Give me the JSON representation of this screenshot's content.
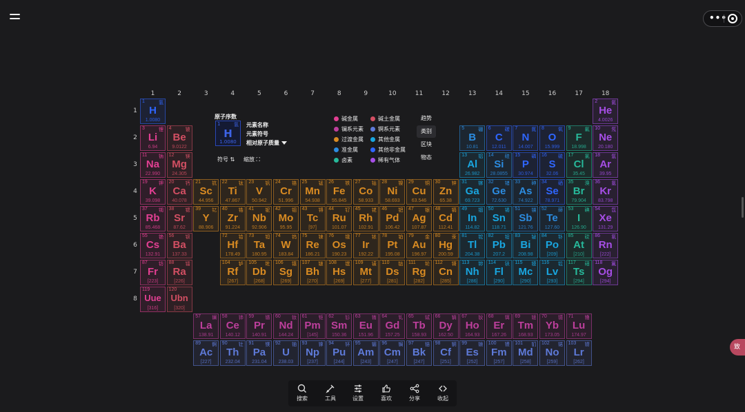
{
  "columns": [
    "1",
    "2",
    "3",
    "4",
    "5",
    "6",
    "7",
    "8",
    "9",
    "10",
    "11",
    "12",
    "13",
    "14",
    "15",
    "16",
    "17",
    "18"
  ],
  "rows": [
    "1",
    "2",
    "3",
    "4",
    "5",
    "6",
    "7",
    "8"
  ],
  "colors": {
    "nonmetal": "#2f66ff",
    "noble": "#a64ee6",
    "alkali": "#e23f92",
    "alkaline": "#d34f63",
    "transition": "#d98b22",
    "post_transition": "#19a6e0",
    "metalloid": "#2c8ce0",
    "halogen": "#27b99a",
    "lanthanide": "#bd3f9c",
    "actinide": "#5e7ad8"
  },
  "legend_key": {
    "number_label": "原子序数",
    "name_label": "元素名称",
    "symbol_label": "元素符号",
    "mass_label": "相对原子质量",
    "sample": {
      "num": "1",
      "zh": "氢",
      "sym": "H",
      "mass": "1.0080"
    },
    "sort_symbol": "符号",
    "zoom": "缩放"
  },
  "legend": [
    {
      "label": "碱金属",
      "color": "#e23f92"
    },
    {
      "label": "碱土金属",
      "color": "#d34f63"
    },
    {
      "label": "镧系元素",
      "color": "#bd3f9c"
    },
    {
      "label": "锕系元素",
      "color": "#5e7ad8"
    },
    {
      "label": "过渡金属",
      "color": "#d98b22"
    },
    {
      "label": "其他金属",
      "color": "#19a6e0"
    },
    {
      "label": "准金属",
      "color": "#2c8ce0"
    },
    {
      "label": "其他非金属",
      "color": "#2f66ff"
    },
    {
      "label": "卤素",
      "color": "#27b99a"
    },
    {
      "label": "稀有气体",
      "color": "#a64ee6"
    }
  ],
  "view_switch": [
    "趋势",
    "类别",
    "区块",
    "物态"
  ],
  "view_switch_active": "类别",
  "toolbar": [
    {
      "label": "搜索",
      "icon": "search-icon"
    },
    {
      "label": "工具",
      "icon": "tool-icon"
    },
    {
      "label": "设置",
      "icon": "settings-icon"
    },
    {
      "label": "喜欢",
      "icon": "like-icon"
    },
    {
      "label": "分享",
      "icon": "share-icon"
    },
    {
      "label": "收起",
      "icon": "collapse-icon"
    }
  ],
  "side_tab": "致",
  "elements": [
    {
      "n": "1",
      "zh": "氢",
      "s": "H",
      "m": "1.0080",
      "c": "nonmetal",
      "r": 1,
      "g": 1
    },
    {
      "n": "2",
      "zh": "氦",
      "s": "He",
      "m": "4.0026",
      "c": "noble",
      "r": 1,
      "g": 18
    },
    {
      "n": "3",
      "zh": "锂",
      "s": "Li",
      "m": "6.94",
      "c": "alkali",
      "r": 2,
      "g": 1
    },
    {
      "n": "4",
      "zh": "铍",
      "s": "Be",
      "m": "9.0122",
      "c": "alkaline",
      "r": 2,
      "g": 2
    },
    {
      "n": "5",
      "zh": "硼",
      "s": "B",
      "m": "10.81",
      "c": "metalloid",
      "r": 2,
      "g": 13
    },
    {
      "n": "6",
      "zh": "碳",
      "s": "C",
      "m": "12.011",
      "c": "nonmetal",
      "r": 2,
      "g": 14
    },
    {
      "n": "7",
      "zh": "氮",
      "s": "N",
      "m": "14.007",
      "c": "nonmetal",
      "r": 2,
      "g": 15
    },
    {
      "n": "8",
      "zh": "氧",
      "s": "O",
      "m": "15.999",
      "c": "nonmetal",
      "r": 2,
      "g": 16
    },
    {
      "n": "9",
      "zh": "氟",
      "s": "F",
      "m": "18.998",
      "c": "halogen",
      "r": 2,
      "g": 17
    },
    {
      "n": "10",
      "zh": "氖",
      "s": "Ne",
      "m": "20.180",
      "c": "noble",
      "r": 2,
      "g": 18
    },
    {
      "n": "11",
      "zh": "钠",
      "s": "Na",
      "m": "22.990",
      "c": "alkali",
      "r": 3,
      "g": 1
    },
    {
      "n": "12",
      "zh": "镁",
      "s": "Mg",
      "m": "24.305",
      "c": "alkaline",
      "r": 3,
      "g": 2
    },
    {
      "n": "13",
      "zh": "铝",
      "s": "Al",
      "m": "26.982",
      "c": "post_transition",
      "r": 3,
      "g": 13
    },
    {
      "n": "14",
      "zh": "硅",
      "s": "Si",
      "m": "28.0855",
      "c": "metalloid",
      "r": 3,
      "g": 14
    },
    {
      "n": "15",
      "zh": "磷",
      "s": "P",
      "m": "30.974",
      "c": "nonmetal",
      "r": 3,
      "g": 15
    },
    {
      "n": "16",
      "zh": "硫",
      "s": "S",
      "m": "32.06",
      "c": "nonmetal",
      "r": 3,
      "g": 16
    },
    {
      "n": "17",
      "zh": "氯",
      "s": "Cl",
      "m": "35.45",
      "c": "halogen",
      "r": 3,
      "g": 17
    },
    {
      "n": "18",
      "zh": "氩",
      "s": "Ar",
      "m": "39.95",
      "c": "noble",
      "r": 3,
      "g": 18
    },
    {
      "n": "19",
      "zh": "钾",
      "s": "K",
      "m": "39.098",
      "c": "alkali",
      "r": 4,
      "g": 1
    },
    {
      "n": "20",
      "zh": "钙",
      "s": "Ca",
      "m": "40.078",
      "c": "alkaline",
      "r": 4,
      "g": 2
    },
    {
      "n": "21",
      "zh": "钪",
      "s": "Sc",
      "m": "44.956",
      "c": "transition",
      "r": 4,
      "g": 3
    },
    {
      "n": "22",
      "zh": "钛",
      "s": "Ti",
      "m": "47.867",
      "c": "transition",
      "r": 4,
      "g": 4
    },
    {
      "n": "23",
      "zh": "钒",
      "s": "V",
      "m": "50.942",
      "c": "transition",
      "r": 4,
      "g": 5
    },
    {
      "n": "24",
      "zh": "铬",
      "s": "Cr",
      "m": "51.996",
      "c": "transition",
      "r": 4,
      "g": 6
    },
    {
      "n": "25",
      "zh": "锰",
      "s": "Mn",
      "m": "54.938",
      "c": "transition",
      "r": 4,
      "g": 7
    },
    {
      "n": "26",
      "zh": "铁",
      "s": "Fe",
      "m": "55.845",
      "c": "transition",
      "r": 4,
      "g": 8
    },
    {
      "n": "27",
      "zh": "钴",
      "s": "Co",
      "m": "58.933",
      "c": "transition",
      "r": 4,
      "g": 9
    },
    {
      "n": "28",
      "zh": "镍",
      "s": "Ni",
      "m": "58.693",
      "c": "transition",
      "r": 4,
      "g": 10
    },
    {
      "n": "29",
      "zh": "铜",
      "s": "Cu",
      "m": "63.546",
      "c": "transition",
      "r": 4,
      "g": 11
    },
    {
      "n": "30",
      "zh": "锌",
      "s": "Zn",
      "m": "65.38",
      "c": "transition",
      "r": 4,
      "g": 12
    },
    {
      "n": "31",
      "zh": "镓",
      "s": "Ga",
      "m": "69.723",
      "c": "post_transition",
      "r": 4,
      "g": 13
    },
    {
      "n": "32",
      "zh": "锗",
      "s": "Ge",
      "m": "72.630",
      "c": "metalloid",
      "r": 4,
      "g": 14
    },
    {
      "n": "33",
      "zh": "砷",
      "s": "As",
      "m": "74.922",
      "c": "metalloid",
      "r": 4,
      "g": 15
    },
    {
      "n": "34",
      "zh": "硒",
      "s": "Se",
      "m": "78.971",
      "c": "nonmetal",
      "r": 4,
      "g": 16
    },
    {
      "n": "35",
      "zh": "溴",
      "s": "Br",
      "m": "79.904",
      "c": "halogen",
      "r": 4,
      "g": 17
    },
    {
      "n": "36",
      "zh": "氪",
      "s": "Kr",
      "m": "83.798",
      "c": "noble",
      "r": 4,
      "g": 18
    },
    {
      "n": "37",
      "zh": "铷",
      "s": "Rb",
      "m": "85.468",
      "c": "alkali",
      "r": 5,
      "g": 1
    },
    {
      "n": "38",
      "zh": "锶",
      "s": "Sr",
      "m": "87.62",
      "c": "alkaline",
      "r": 5,
      "g": 2
    },
    {
      "n": "39",
      "zh": "钇",
      "s": "Y",
      "m": "88.906",
      "c": "transition",
      "r": 5,
      "g": 3
    },
    {
      "n": "40",
      "zh": "锆",
      "s": "Zr",
      "m": "91.224",
      "c": "transition",
      "r": 5,
      "g": 4
    },
    {
      "n": "41",
      "zh": "铌",
      "s": "Nb",
      "m": "92.906",
      "c": "transition",
      "r": 5,
      "g": 5
    },
    {
      "n": "42",
      "zh": "钼",
      "s": "Mo",
      "m": "95.95",
      "c": "transition",
      "r": 5,
      "g": 6
    },
    {
      "n": "43",
      "zh": "锝",
      "s": "Tc",
      "m": "[97]",
      "c": "transition",
      "r": 5,
      "g": 7
    },
    {
      "n": "44",
      "zh": "钌",
      "s": "Ru",
      "m": "101.07",
      "c": "transition",
      "r": 5,
      "g": 8
    },
    {
      "n": "45",
      "zh": "铑",
      "s": "Rh",
      "m": "102.91",
      "c": "transition",
      "r": 5,
      "g": 9
    },
    {
      "n": "46",
      "zh": "钯",
      "s": "Pd",
      "m": "106.42",
      "c": "transition",
      "r": 5,
      "g": 10
    },
    {
      "n": "47",
      "zh": "银",
      "s": "Ag",
      "m": "107.87",
      "c": "transition",
      "r": 5,
      "g": 11
    },
    {
      "n": "48",
      "zh": "镉",
      "s": "Cd",
      "m": "112.41",
      "c": "transition",
      "r": 5,
      "g": 12
    },
    {
      "n": "49",
      "zh": "铟",
      "s": "In",
      "m": "114.82",
      "c": "post_transition",
      "r": 5,
      "g": 13
    },
    {
      "n": "50",
      "zh": "锡",
      "s": "Sn",
      "m": "118.71",
      "c": "post_transition",
      "r": 5,
      "g": 14
    },
    {
      "n": "51",
      "zh": "锑",
      "s": "Sb",
      "m": "121.76",
      "c": "metalloid",
      "r": 5,
      "g": 15
    },
    {
      "n": "52",
      "zh": "碲",
      "s": "Te",
      "m": "127.60",
      "c": "metalloid",
      "r": 5,
      "g": 16
    },
    {
      "n": "53",
      "zh": "碘",
      "s": "I",
      "m": "126.90",
      "c": "halogen",
      "r": 5,
      "g": 17
    },
    {
      "n": "54",
      "zh": "氙",
      "s": "Xe",
      "m": "131.29",
      "c": "noble",
      "r": 5,
      "g": 18
    },
    {
      "n": "55",
      "zh": "铯",
      "s": "Cs",
      "m": "132.91",
      "c": "alkali",
      "r": 6,
      "g": 1
    },
    {
      "n": "56",
      "zh": "钡",
      "s": "Ba",
      "m": "137.33",
      "c": "alkaline",
      "r": 6,
      "g": 2
    },
    {
      "n": "72",
      "zh": "铪",
      "s": "Hf",
      "m": "178.49",
      "c": "transition",
      "r": 6,
      "g": 4
    },
    {
      "n": "73",
      "zh": "钽",
      "s": "Ta",
      "m": "180.95",
      "c": "transition",
      "r": 6,
      "g": 5
    },
    {
      "n": "74",
      "zh": "钨",
      "s": "W",
      "m": "183.84",
      "c": "transition",
      "r": 6,
      "g": 6
    },
    {
      "n": "75",
      "zh": "铼",
      "s": "Re",
      "m": "186.21",
      "c": "transition",
      "r": 6,
      "g": 7
    },
    {
      "n": "76",
      "zh": "锇",
      "s": "Os",
      "m": "190.23",
      "c": "transition",
      "r": 6,
      "g": 8
    },
    {
      "n": "77",
      "zh": "铱",
      "s": "Ir",
      "m": "192.22",
      "c": "transition",
      "r": 6,
      "g": 9
    },
    {
      "n": "78",
      "zh": "铂",
      "s": "Pt",
      "m": "195.08",
      "c": "transition",
      "r": 6,
      "g": 10
    },
    {
      "n": "79",
      "zh": "金",
      "s": "Au",
      "m": "196.97",
      "c": "transition",
      "r": 6,
      "g": 11
    },
    {
      "n": "80",
      "zh": "汞",
      "s": "Hg",
      "m": "200.59",
      "c": "transition",
      "r": 6,
      "g": 12
    },
    {
      "n": "81",
      "zh": "铊",
      "s": "Tl",
      "m": "204.38",
      "c": "post_transition",
      "r": 6,
      "g": 13
    },
    {
      "n": "82",
      "zh": "铅",
      "s": "Pb",
      "m": "207.2",
      "c": "post_transition",
      "r": 6,
      "g": 14
    },
    {
      "n": "83",
      "zh": "铋",
      "s": "Bi",
      "m": "208.98",
      "c": "post_transition",
      "r": 6,
      "g": 15
    },
    {
      "n": "84",
      "zh": "钋",
      "s": "Po",
      "m": "[209]",
      "c": "post_transition",
      "r": 6,
      "g": 16
    },
    {
      "n": "85",
      "zh": "砹",
      "s": "At",
      "m": "[210]",
      "c": "halogen",
      "r": 6,
      "g": 17
    },
    {
      "n": "86",
      "zh": "氡",
      "s": "Rn",
      "m": "[222]",
      "c": "noble",
      "r": 6,
      "g": 18
    },
    {
      "n": "87",
      "zh": "钫",
      "s": "Fr",
      "m": "[223]",
      "c": "alkali",
      "r": 7,
      "g": 1
    },
    {
      "n": "88",
      "zh": "镭",
      "s": "Ra",
      "m": "[226]",
      "c": "alkaline",
      "r": 7,
      "g": 2
    },
    {
      "n": "104",
      "zh": "𬬻",
      "s": "Rf",
      "m": "[267]",
      "c": "transition",
      "r": 7,
      "g": 4
    },
    {
      "n": "105",
      "zh": "𬭊",
      "s": "Db",
      "m": "[268]",
      "c": "transition",
      "r": 7,
      "g": 5
    },
    {
      "n": "106",
      "zh": "𬭳",
      "s": "Sg",
      "m": "[269]",
      "c": "transition",
      "r": 7,
      "g": 6
    },
    {
      "n": "107",
      "zh": "𬭛",
      "s": "Bh",
      "m": "[270]",
      "c": "transition",
      "r": 7,
      "g": 7
    },
    {
      "n": "108",
      "zh": "𬭶",
      "s": "Hs",
      "m": "[269]",
      "c": "transition",
      "r": 7,
      "g": 8
    },
    {
      "n": "109",
      "zh": "鿏",
      "s": "Mt",
      "m": "[277]",
      "c": "transition",
      "r": 7,
      "g": 9
    },
    {
      "n": "110",
      "zh": "𫟼",
      "s": "Ds",
      "m": "[281]",
      "c": "transition",
      "r": 7,
      "g": 10
    },
    {
      "n": "111",
      "zh": "𬬭",
      "s": "Rg",
      "m": "[282]",
      "c": "transition",
      "r": 7,
      "g": 11
    },
    {
      "n": "112",
      "zh": "鿔",
      "s": "Cn",
      "m": "[285]",
      "c": "transition",
      "r": 7,
      "g": 12
    },
    {
      "n": "113",
      "zh": "鿭",
      "s": "Nh",
      "m": "[286]",
      "c": "post_transition",
      "r": 7,
      "g": 13
    },
    {
      "n": "114",
      "zh": "𫓧",
      "s": "Fl",
      "m": "[290]",
      "c": "post_transition",
      "r": 7,
      "g": 14
    },
    {
      "n": "115",
      "zh": "镆",
      "s": "Mc",
      "m": "[290]",
      "c": "post_transition",
      "r": 7,
      "g": 15
    },
    {
      "n": "116",
      "zh": "𫟷",
      "s": "Lv",
      "m": "[293]",
      "c": "post_transition",
      "r": 7,
      "g": 16
    },
    {
      "n": "117",
      "zh": "鿬",
      "s": "Ts",
      "m": "[294]",
      "c": "halogen",
      "r": 7,
      "g": 17
    },
    {
      "n": "118",
      "zh": "鿫",
      "s": "Og",
      "m": "[294]",
      "c": "noble",
      "r": 7,
      "g": 18
    },
    {
      "n": "119",
      "zh": "",
      "s": "Uue",
      "m": "[316]",
      "c": "alkali",
      "r": 8,
      "g": 1
    },
    {
      "n": "120",
      "zh": "",
      "s": "Ubn",
      "m": "[320]",
      "c": "alkaline",
      "r": 8,
      "g": 2
    },
    {
      "n": "57",
      "zh": "镧",
      "s": "La",
      "m": "138.91",
      "c": "lanthanide",
      "r": 9,
      "g": 3
    },
    {
      "n": "58",
      "zh": "铈",
      "s": "Ce",
      "m": "140.12",
      "c": "lanthanide",
      "r": 9,
      "g": 4
    },
    {
      "n": "59",
      "zh": "镨",
      "s": "Pr",
      "m": "140.91",
      "c": "lanthanide",
      "r": 9,
      "g": 5
    },
    {
      "n": "60",
      "zh": "钕",
      "s": "Nd",
      "m": "144.24",
      "c": "lanthanide",
      "r": 9,
      "g": 6
    },
    {
      "n": "61",
      "zh": "钷",
      "s": "Pm",
      "m": "[145]",
      "c": "lanthanide",
      "r": 9,
      "g": 7
    },
    {
      "n": "62",
      "zh": "钐",
      "s": "Sm",
      "m": "150.36",
      "c": "lanthanide",
      "r": 9,
      "g": 8
    },
    {
      "n": "63",
      "zh": "铕",
      "s": "Eu",
      "m": "151.96",
      "c": "lanthanide",
      "r": 9,
      "g": 9
    },
    {
      "n": "64",
      "zh": "钆",
      "s": "Gd",
      "m": "157.25",
      "c": "lanthanide",
      "r": 9,
      "g": 10
    },
    {
      "n": "65",
      "zh": "铽",
      "s": "Tb",
      "m": "158.93",
      "c": "lanthanide",
      "r": 9,
      "g": 11
    },
    {
      "n": "66",
      "zh": "镝",
      "s": "Dy",
      "m": "162.50",
      "c": "lanthanide",
      "r": 9,
      "g": 12
    },
    {
      "n": "67",
      "zh": "钬",
      "s": "Ho",
      "m": "164.93",
      "c": "lanthanide",
      "r": 9,
      "g": 13
    },
    {
      "n": "68",
      "zh": "铒",
      "s": "Er",
      "m": "167.26",
      "c": "lanthanide",
      "r": 9,
      "g": 14
    },
    {
      "n": "69",
      "zh": "铥",
      "s": "Tm",
      "m": "168.93",
      "c": "lanthanide",
      "r": 9,
      "g": 15
    },
    {
      "n": "70",
      "zh": "镱",
      "s": "Yb",
      "m": "173.05",
      "c": "lanthanide",
      "r": 9,
      "g": 16
    },
    {
      "n": "71",
      "zh": "镥",
      "s": "Lu",
      "m": "174.97",
      "c": "lanthanide",
      "r": 9,
      "g": 17
    },
    {
      "n": "89",
      "zh": "锕",
      "s": "Ac",
      "m": "[227]",
      "c": "actinide",
      "r": 10,
      "g": 3
    },
    {
      "n": "90",
      "zh": "钍",
      "s": "Th",
      "m": "232.04",
      "c": "actinide",
      "r": 10,
      "g": 4
    },
    {
      "n": "91",
      "zh": "镤",
      "s": "Pa",
      "m": "231.04",
      "c": "actinide",
      "r": 10,
      "g": 5
    },
    {
      "n": "92",
      "zh": "铀",
      "s": "U",
      "m": "238.03",
      "c": "actinide",
      "r": 10,
      "g": 6
    },
    {
      "n": "93",
      "zh": "镎",
      "s": "Np",
      "m": "[237]",
      "c": "actinide",
      "r": 10,
      "g": 7
    },
    {
      "n": "94",
      "zh": "钚",
      "s": "Pu",
      "m": "[244]",
      "c": "actinide",
      "r": 10,
      "g": 8
    },
    {
      "n": "95",
      "zh": "镅",
      "s": "Am",
      "m": "[243]",
      "c": "actinide",
      "r": 10,
      "g": 9
    },
    {
      "n": "96",
      "zh": "锔",
      "s": "Cm",
      "m": "[247]",
      "c": "actinide",
      "r": 10,
      "g": 10
    },
    {
      "n": "97",
      "zh": "锫",
      "s": "Bk",
      "m": "[247]",
      "c": "actinide",
      "r": 10,
      "g": 11
    },
    {
      "n": "98",
      "zh": "锎",
      "s": "Cf",
      "m": "[251]",
      "c": "actinide",
      "r": 10,
      "g": 12
    },
    {
      "n": "99",
      "zh": "锿",
      "s": "Es",
      "m": "[252]",
      "c": "actinide",
      "r": 10,
      "g": 13
    },
    {
      "n": "100",
      "zh": "镄",
      "s": "Fm",
      "m": "[257]",
      "c": "actinide",
      "r": 10,
      "g": 14
    },
    {
      "n": "101",
      "zh": "钔",
      "s": "Md",
      "m": "[258]",
      "c": "actinide",
      "r": 10,
      "g": 15
    },
    {
      "n": "102",
      "zh": "锘",
      "s": "No",
      "m": "[259]",
      "c": "actinide",
      "r": 10,
      "g": 16
    },
    {
      "n": "103",
      "zh": "铹",
      "s": "Lr",
      "m": "[262]",
      "c": "actinide",
      "r": 10,
      "g": 17
    }
  ]
}
